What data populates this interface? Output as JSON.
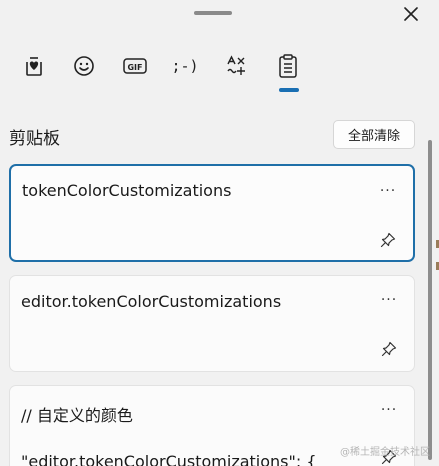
{
  "header": {
    "handle_icon": "drag-handle",
    "close_icon": "close-icon"
  },
  "tabs": [
    {
      "icon": "favorites-heart-icon",
      "label": "",
      "selected": false
    },
    {
      "icon": "emoji-smiley-icon",
      "label": "",
      "selected": false
    },
    {
      "icon": "gif-icon",
      "label": "GIF",
      "selected": false
    },
    {
      "icon": "kaomoji-icon",
      "label": ";-)",
      "selected": false
    },
    {
      "icon": "symbols-icon",
      "label": "",
      "selected": false
    },
    {
      "icon": "clipboard-icon",
      "label": "",
      "selected": true
    }
  ],
  "clipboard": {
    "title": "剪贴板",
    "clear_all_label": "全部清除",
    "items": [
      {
        "text": "tokenColorCustomizations",
        "selected": true,
        "more_label": "···"
      },
      {
        "text": "editor.tokenColorCustomizations",
        "selected": false,
        "more_label": "···"
      },
      {
        "text": "// 自定义的颜色",
        "text2": "\"editor.tokenColorCustomizations\": {",
        "selected": false,
        "more_label": "···"
      }
    ]
  },
  "watermark": "@稀土掘金技术社区",
  "colors": {
    "accent": "#1f6fa8",
    "indicator": "#1a6fb3",
    "background": "#f1f1f1",
    "card": "#fbfbfb"
  }
}
